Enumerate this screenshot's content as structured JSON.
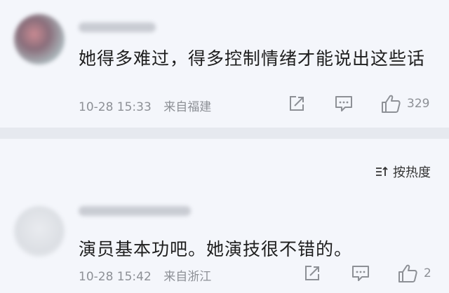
{
  "comments": [
    {
      "text": "她得多难过，得多控制情绪才能说出这些话",
      "time": "10-28 15:33",
      "location": "来自福建",
      "likes": "329"
    },
    {
      "text": "演员基本功吧。她演技很不错的。",
      "time": "10-28 15:42",
      "location": "来自浙江",
      "likes": "2"
    }
  ],
  "sort": {
    "label": "按热度",
    "icon": "sort-icon"
  },
  "icons": {
    "share": "share-icon",
    "reply": "reply-icon",
    "like": "thumbs-up-icon"
  },
  "colors": {
    "meta": "#8d9096",
    "background": "#f4f6fb",
    "divider": "#e6e9ef"
  }
}
